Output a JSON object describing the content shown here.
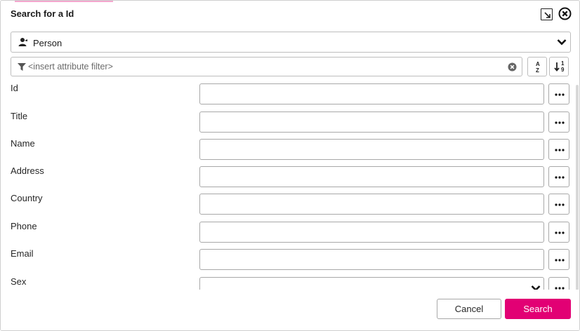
{
  "dialog": {
    "title": "Search for a Id",
    "accent_color": "#e20074"
  },
  "type_selector": {
    "icon": "person-icon",
    "selected": "Person"
  },
  "filter": {
    "placeholder": "<insert attribute filter>",
    "value": ""
  },
  "sort_buttons": {
    "alpha": {
      "top": "A",
      "bottom": "Z"
    },
    "numeric": {
      "top": "1",
      "bottom": "9"
    }
  },
  "fields": [
    {
      "label": "Id",
      "value": ""
    },
    {
      "label": "Title",
      "value": ""
    },
    {
      "label": "Name",
      "value": ""
    },
    {
      "label": "Address",
      "value": ""
    },
    {
      "label": "Country",
      "value": ""
    },
    {
      "label": "Phone",
      "value": ""
    },
    {
      "label": "Email",
      "value": ""
    },
    {
      "label": "Sex",
      "value": ""
    }
  ],
  "footer": {
    "cancel_label": "Cancel",
    "search_label": "Search"
  }
}
